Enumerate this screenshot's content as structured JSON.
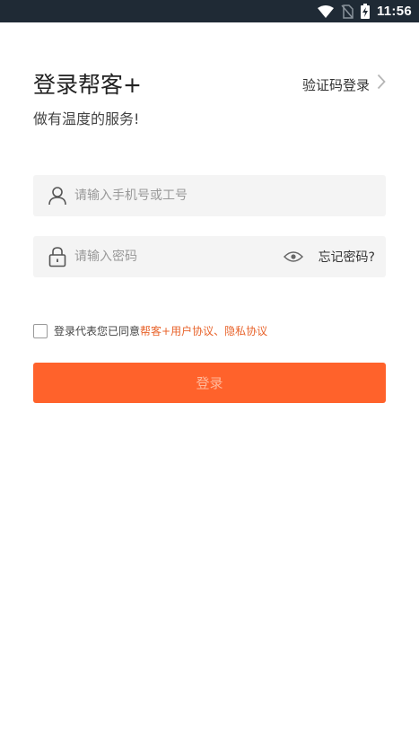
{
  "status_bar": {
    "time": "11:56",
    "icons": [
      "wifi-icon",
      "no-sim-icon",
      "battery-charging-icon"
    ]
  },
  "header": {
    "title": "登录帮客+",
    "alt_login_label": "验证码登录",
    "subtitle": "做有温度的服务!"
  },
  "form": {
    "username": {
      "placeholder": "请输入手机号或工号",
      "value": "",
      "icon": "user-icon"
    },
    "password": {
      "placeholder": "请输入密码",
      "value": "",
      "icon": "lock-icon"
    },
    "show_password_icon": "eye-icon",
    "forgot_label": "忘记密码?"
  },
  "agreement": {
    "checked": false,
    "prefix": "登录代表您已同意",
    "user_agreement": "帮客+用户协议",
    "separator": "、",
    "privacy_policy": "隐私协议"
  },
  "login_button": {
    "label": "登录"
  },
  "colors": {
    "accent": "#ff622b",
    "link": "#e8642c",
    "status_bar_bg": "#1f2a35",
    "field_bg": "#f4f4f4"
  }
}
